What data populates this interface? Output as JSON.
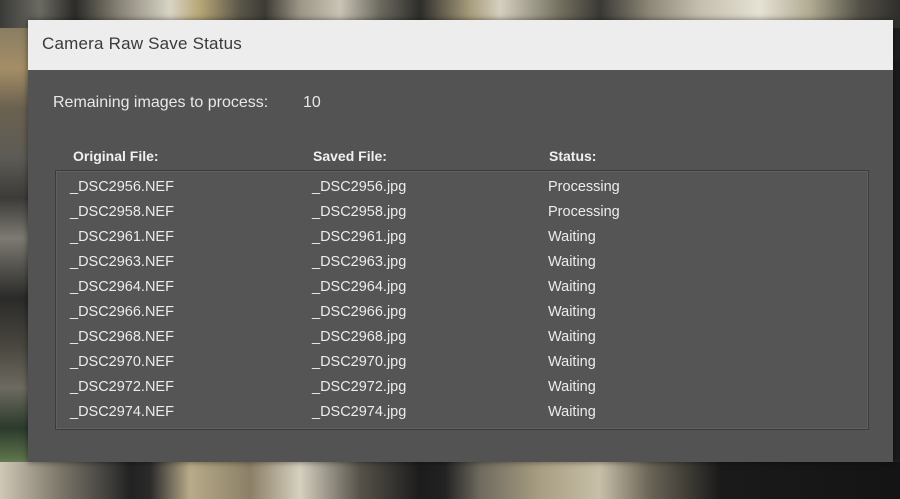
{
  "dialog": {
    "title": "Camera Raw Save Status",
    "remaining_label": "Remaining images to process:",
    "remaining_count": "10"
  },
  "table": {
    "columns": [
      "Original File:",
      "Saved File:",
      "Status:"
    ],
    "rows": [
      {
        "original": "_DSC2956.NEF",
        "saved": "_DSC2956.jpg",
        "status": "Processing"
      },
      {
        "original": "_DSC2958.NEF",
        "saved": "_DSC2958.jpg",
        "status": "Processing"
      },
      {
        "original": "_DSC2961.NEF",
        "saved": "_DSC2961.jpg",
        "status": "Waiting"
      },
      {
        "original": "_DSC2963.NEF",
        "saved": "_DSC2963.jpg",
        "status": "Waiting"
      },
      {
        "original": "_DSC2964.NEF",
        "saved": "_DSC2964.jpg",
        "status": "Waiting"
      },
      {
        "original": "_DSC2966.NEF",
        "saved": "_DSC2966.jpg",
        "status": "Waiting"
      },
      {
        "original": "_DSC2968.NEF",
        "saved": "_DSC2968.jpg",
        "status": "Waiting"
      },
      {
        "original": "_DSC2970.NEF",
        "saved": "_DSC2970.jpg",
        "status": "Waiting"
      },
      {
        "original": "_DSC2972.NEF",
        "saved": "_DSC2972.jpg",
        "status": "Waiting"
      },
      {
        "original": "_DSC2974.NEF",
        "saved": "_DSC2974.jpg",
        "status": "Waiting"
      }
    ]
  }
}
